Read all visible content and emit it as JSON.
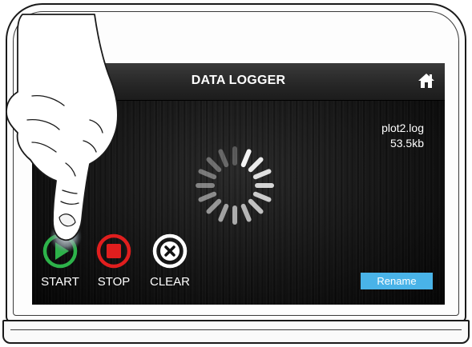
{
  "header": {
    "title": "DATA LOGGER",
    "home_icon": "home-icon"
  },
  "file": {
    "name": "plot2.log",
    "size": "53.5kb"
  },
  "status": {
    "loading_indicator": "spinner-icon"
  },
  "controls": [
    {
      "label": "START",
      "icon": "play-icon",
      "color": "#2db34a"
    },
    {
      "label": "STOP",
      "icon": "stop-icon",
      "color": "#e01e1e"
    },
    {
      "label": "CLEAR",
      "icon": "clear-icon",
      "color": "#ffffff"
    }
  ],
  "rename": {
    "label": "Rename",
    "color": "#49b3e8"
  },
  "colors": {
    "screen_bg": "#111111",
    "titlebar": "#2a2a2a",
    "text": "#ffffff"
  }
}
